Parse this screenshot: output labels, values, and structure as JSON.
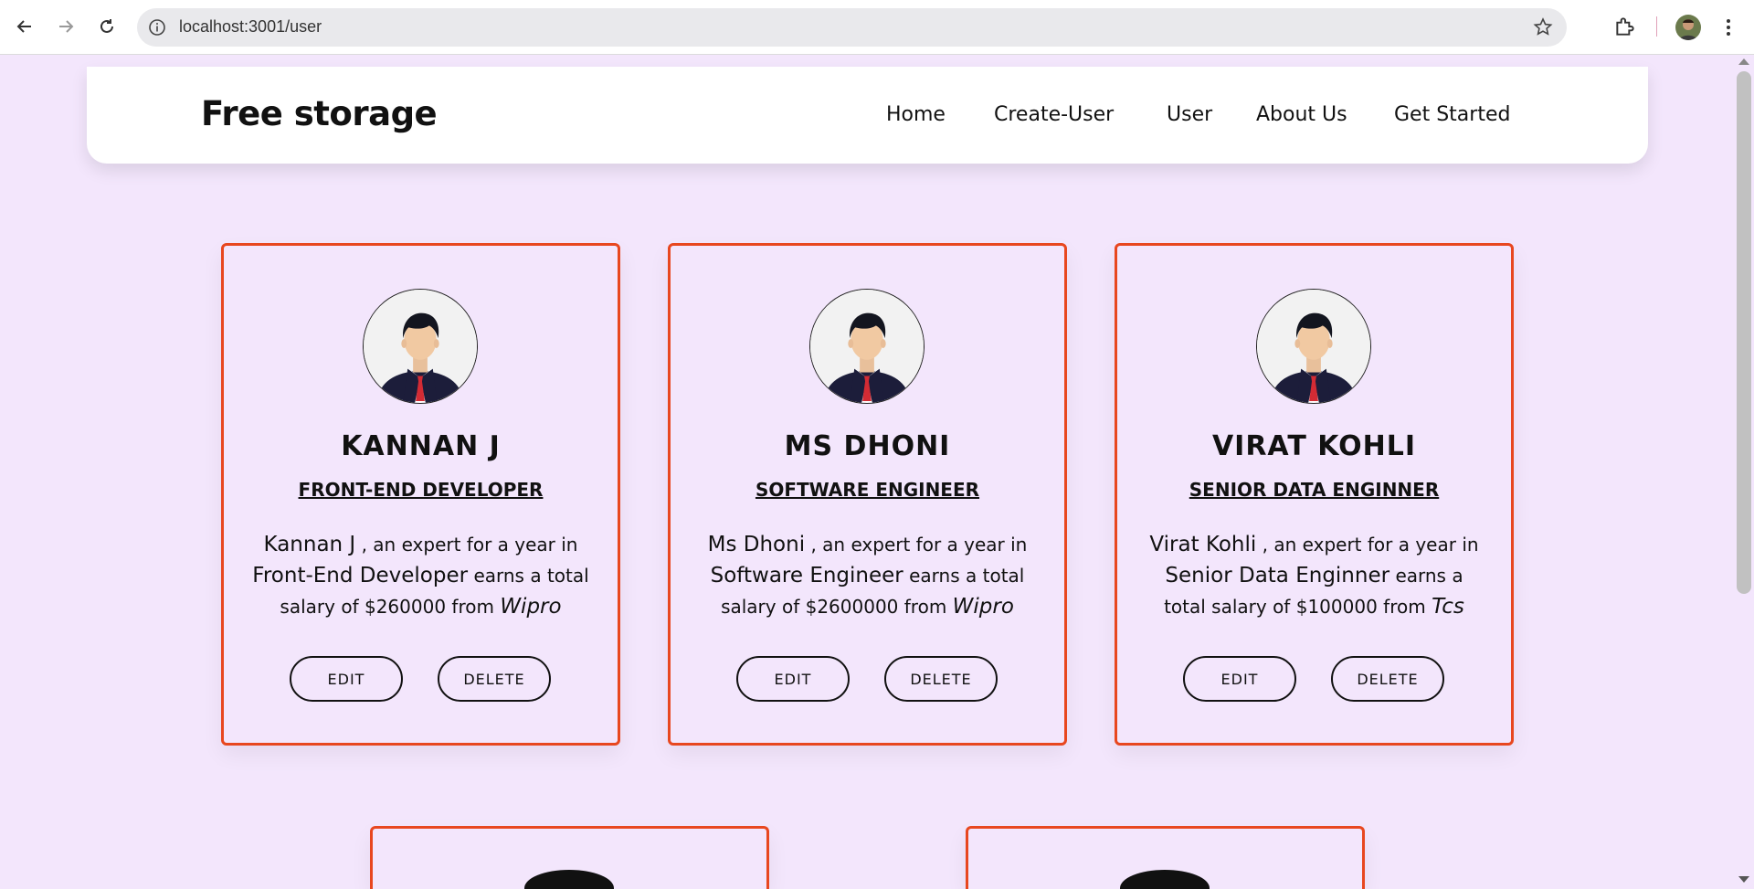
{
  "browser": {
    "url": "localhost:3001/user"
  },
  "site": {
    "brand": "Free storage",
    "nav": [
      "Home",
      "Create-User",
      "User",
      "About Us",
      "Get Started"
    ]
  },
  "users": [
    {
      "name": "KANNAN J",
      "role": "FRONT-END DEVELOPER",
      "person": "Kannan J",
      "expertise": "Front-End Developer",
      "salary": "$260000",
      "company": "Wipro"
    },
    {
      "name": "MS DHONI",
      "role": "SOFTWARE ENGINEER",
      "person": "Ms Dhoni",
      "expertise": "Software Engineer",
      "salary": "$2600000",
      "company": "Wipro"
    },
    {
      "name": "VIRAT KOHLI",
      "role": "SENIOR DATA ENGINNER",
      "person": "Virat Kohli",
      "expertise": "Senior Data Enginner",
      "salary": "$100000",
      "company": "Tcs"
    }
  ],
  "card_text": {
    "expert_phrase": ", an expert for a year in",
    "earns_phrase": "earns a total salary of",
    "from_phrase": "from",
    "edit_label": "EDIT",
    "delete_label": "DELETE"
  },
  "colors": {
    "page_bg": "#f3e6fc",
    "card_border": "#e8471f"
  }
}
